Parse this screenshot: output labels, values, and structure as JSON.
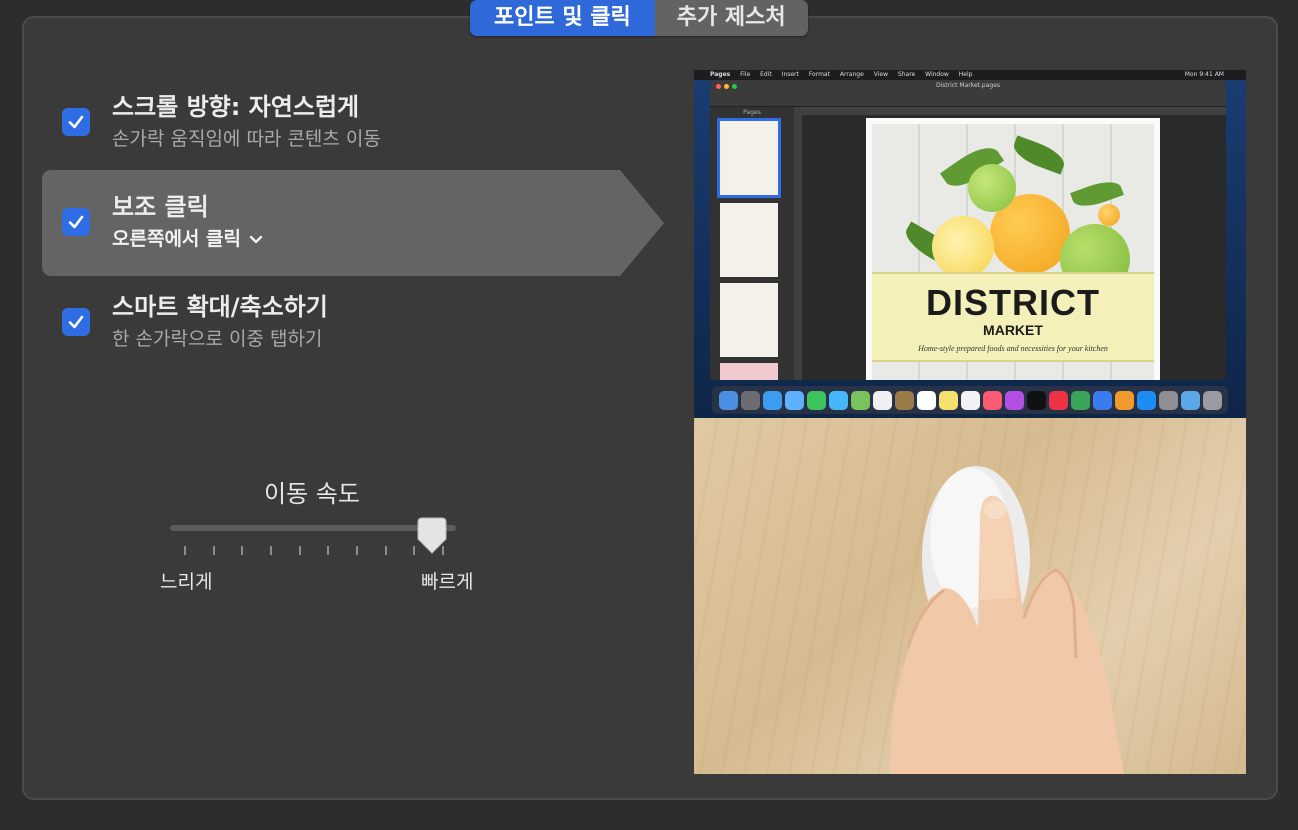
{
  "tabs": [
    {
      "label": "포인트 및 클릭",
      "active": true
    },
    {
      "label": "추가 제스처",
      "active": false
    }
  ],
  "options": [
    {
      "title": "스크롤 방향: 자연스럽게",
      "subtitle": "손가락 움직임에 따라 콘텐츠 이동",
      "checked": true,
      "selected": false
    },
    {
      "title": "보조 클릭",
      "subtitle": "오른쪽에서 클릭",
      "checked": true,
      "selected": true,
      "has_dropdown": true
    },
    {
      "title": "스마트 확대/축소하기",
      "subtitle": "한 손가락으로 이중 탭하기",
      "checked": true,
      "selected": false
    }
  ],
  "tracking": {
    "title": "이동 속도",
    "min_label": "느리게",
    "max_label": "빠르게",
    "value_fraction": 0.96,
    "tick_count": 10
  },
  "preview": {
    "menubar": {
      "items": [
        "Pages",
        "File",
        "Edit",
        "Insert",
        "Format",
        "Arrange",
        "View",
        "Share",
        "Window",
        "Help"
      ],
      "clock": "Mon 9:41 AM"
    },
    "document_title": "District Market.pages",
    "sidebar_label": "Pages",
    "page_title": "DISTRICT",
    "page_subtitle": "MARKET",
    "page_tagline": "Home-style prepared foods and necessities for your kitchen"
  },
  "colors": {
    "accent": "#2f69d9",
    "checkbox": "#2f6de4",
    "panel": "#3a3a3a",
    "selected_row": "#646464"
  }
}
